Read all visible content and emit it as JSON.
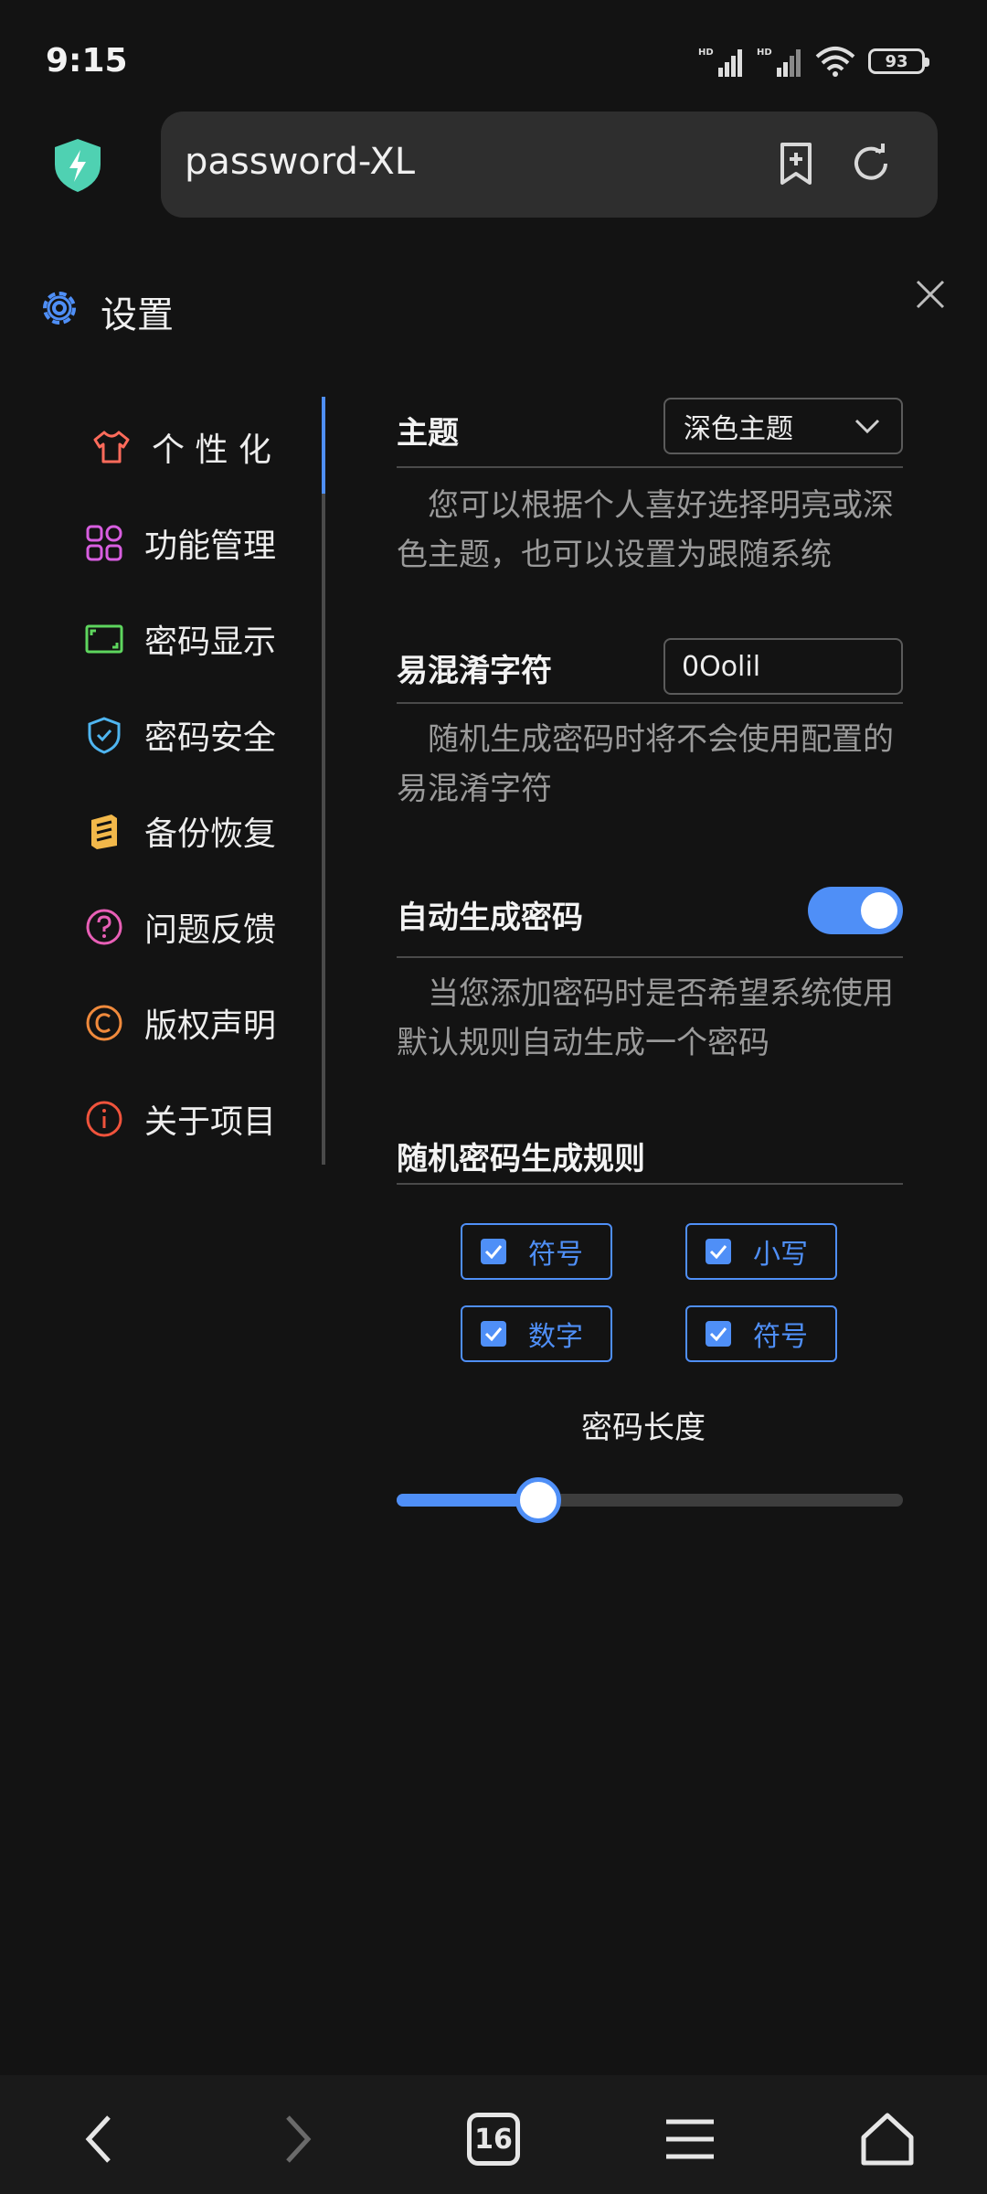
{
  "status_bar": {
    "time": "9:15",
    "battery": "93",
    "signal_labels": [
      "HD",
      "HD"
    ]
  },
  "browser": {
    "url": "password-XL"
  },
  "settings": {
    "title": "设置"
  },
  "sidebar": {
    "items": [
      {
        "label": "个 性 化",
        "icon": "tshirt-icon",
        "color": "#ff6b5b"
      },
      {
        "label": "功能管理",
        "icon": "apps-icon",
        "color": "#d85ee0"
      },
      {
        "label": "密码显示",
        "icon": "screen-icon",
        "color": "#5ed65e"
      },
      {
        "label": "密码安全",
        "icon": "shield-check-icon",
        "color": "#4fb5f0"
      },
      {
        "label": "备份恢复",
        "icon": "archive-icon",
        "color": "#f2b84a"
      },
      {
        "label": "问题反馈",
        "icon": "question-icon",
        "color": "#e85fb6"
      },
      {
        "label": "版权声明",
        "icon": "copyright-icon",
        "color": "#f08a3c"
      },
      {
        "label": "关于项目",
        "icon": "info-icon",
        "color": "#f0533c"
      }
    ]
  },
  "content": {
    "theme": {
      "title": "主题",
      "selected": "深色主题",
      "desc": "您可以根据个人喜好选择明亮或深色主题，也可以设置为跟随系统"
    },
    "confusing": {
      "title": "易混淆字符",
      "value": "0Oolil",
      "desc": "随机生成密码时将不会使用配置的易混淆字符"
    },
    "auto_gen": {
      "title": "自动生成密码",
      "enabled": true,
      "desc": "当您添加密码时是否希望系统使用默认规则自动生成一个密码"
    },
    "rules": {
      "title": "随机密码生成规则",
      "options": [
        {
          "label": "符号",
          "checked": true
        },
        {
          "label": "小写",
          "checked": true
        },
        {
          "label": "数字",
          "checked": true
        },
        {
          "label": "符号",
          "checked": true
        }
      ],
      "length_label": "密码长度",
      "length_fraction": 0.28
    }
  },
  "bottom_nav": {
    "tab_count": "16"
  },
  "colors": {
    "accent": "#4f8ff7",
    "background": "#131313"
  }
}
